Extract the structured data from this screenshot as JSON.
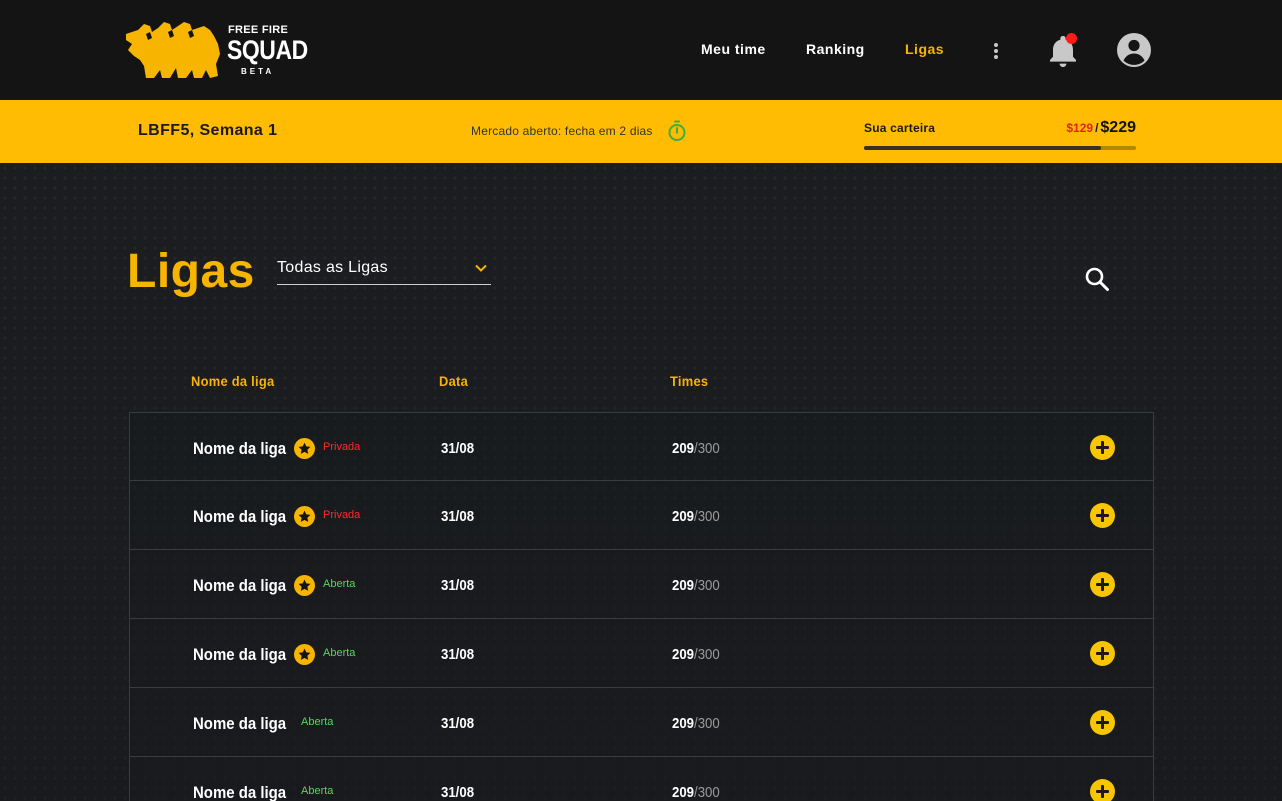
{
  "header": {
    "logo": {
      "line1": "FREE FIRE",
      "line2": "SQUAD",
      "line3": "BETA",
      "accent": "#f7b500"
    },
    "nav": [
      {
        "label": "Meu time",
        "active": false
      },
      {
        "label": "Ranking",
        "active": false
      },
      {
        "label": "Ligas",
        "active": true
      }
    ],
    "icons": [
      "more-vertical-icon",
      "bell-icon",
      "user-avatar-icon"
    ],
    "has_notification": true
  },
  "status_bar": {
    "season": "LBFF5, Semana 1",
    "market": "Mercado aberto: fecha em 2 dias",
    "wallet_label": "Sua carteira",
    "wallet_spent": "$129",
    "wallet_separator": "/",
    "wallet_total": "$229",
    "wallet_fraction": 0.87,
    "background": "#ffbc03"
  },
  "page": {
    "title": "Ligas",
    "filter_value": "Todas as Ligas"
  },
  "table": {
    "columns": [
      "Nome da liga",
      "Data",
      "Times"
    ],
    "rows": [
      {
        "name": "Nome da liga",
        "star": true,
        "status": "Privada",
        "status_type": "priv",
        "date": "31/08",
        "teams": "209",
        "teams_max": "/300"
      },
      {
        "name": "Nome da liga",
        "star": true,
        "status": "Privada",
        "status_type": "priv",
        "date": "31/08",
        "teams": "209",
        "teams_max": "/300"
      },
      {
        "name": "Nome da liga",
        "star": true,
        "status": "Aberta",
        "status_type": "open",
        "date": "31/08",
        "teams": "209",
        "teams_max": "/300"
      },
      {
        "name": "Nome da liga",
        "star": true,
        "status": "Aberta",
        "status_type": "open",
        "date": "31/08",
        "teams": "209",
        "teams_max": "/300"
      },
      {
        "name": "Nome da liga",
        "star": false,
        "status": "Aberta",
        "status_type": "open",
        "date": "31/08",
        "teams": "209",
        "teams_max": "/300"
      },
      {
        "name": "Nome da liga",
        "star": false,
        "status": "Aberta",
        "status_type": "open",
        "date": "31/08",
        "teams": "209",
        "teams_max": "/300"
      }
    ]
  }
}
